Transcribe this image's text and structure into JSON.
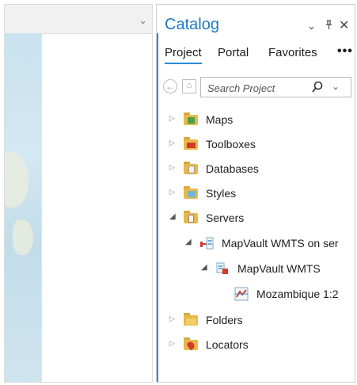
{
  "catalog": {
    "title": "Catalog",
    "controls": {
      "menu_icon": "chevron-down-icon",
      "pin_icon": "pin-icon",
      "close_icon": "close-icon"
    },
    "tabs": [
      {
        "label": "Project",
        "active": true
      },
      {
        "label": "Portal",
        "active": false
      },
      {
        "label": "Favorites",
        "active": false
      }
    ],
    "more_label": "•••",
    "search": {
      "placeholder": "Search Project"
    },
    "tree": [
      {
        "label": "Maps",
        "expanded": false,
        "icon": "maps-folder-icon"
      },
      {
        "label": "Toolboxes",
        "expanded": false,
        "icon": "toolboxes-folder-icon"
      },
      {
        "label": "Databases",
        "expanded": false,
        "icon": "databases-folder-icon"
      },
      {
        "label": "Styles",
        "expanded": false,
        "icon": "styles-folder-icon"
      },
      {
        "label": "Servers",
        "expanded": true,
        "icon": "servers-folder-icon"
      },
      {
        "label": "MapVault WMTS on ser",
        "expanded": true,
        "icon": "server-connection-icon"
      },
      {
        "label": "MapVault WMTS",
        "expanded": true,
        "icon": "wmts-service-icon"
      },
      {
        "label": "Mozambique 1:2",
        "expanded": false,
        "icon": "map-layer-icon"
      },
      {
        "label": "Folders",
        "expanded": false,
        "icon": "folders-folder-icon"
      },
      {
        "label": "Locators",
        "expanded": false,
        "icon": "locators-folder-icon"
      }
    ]
  },
  "colors": {
    "accent": "#2a8bd6",
    "title": "#1f7ac2",
    "folder": "#e8b84a"
  }
}
